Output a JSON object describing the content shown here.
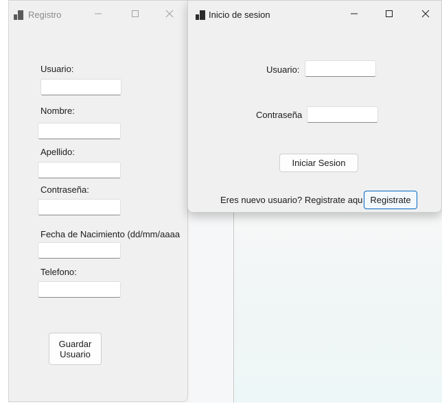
{
  "registro": {
    "title": "Registro",
    "labels": {
      "usuario": "Usuario:",
      "nombre": "Nombre:",
      "apellido": "Apellido:",
      "contrasena": "Contraseña:",
      "fecha": "Fecha de Nacimiento (dd/mm/aaaa",
      "telefono": "Telefono:"
    },
    "values": {
      "usuario": "",
      "nombre": "",
      "apellido": "",
      "contrasena": "",
      "fecha": "",
      "telefono": ""
    },
    "save_button_line1": "Guardar",
    "save_button_line2": "Usuario"
  },
  "login": {
    "title": "Inicio de sesion",
    "usuario_label": "Usuario:",
    "usuario_value": "",
    "contrasena_label": "Contraseña",
    "contrasena_value": "",
    "login_button": "Iniciar Sesion",
    "prompt": "Eres nuevo usuario? Registrate aqu",
    "register_button": "Registrate"
  },
  "icons": {
    "app": "app-window-icon",
    "minimize": "minimize-icon",
    "maximize": "maximize-icon",
    "close": "close-icon"
  },
  "colors": {
    "window_bg": "#f0f0f0",
    "accent": "#0067c0",
    "inactive_title": "#8a8a8a"
  }
}
